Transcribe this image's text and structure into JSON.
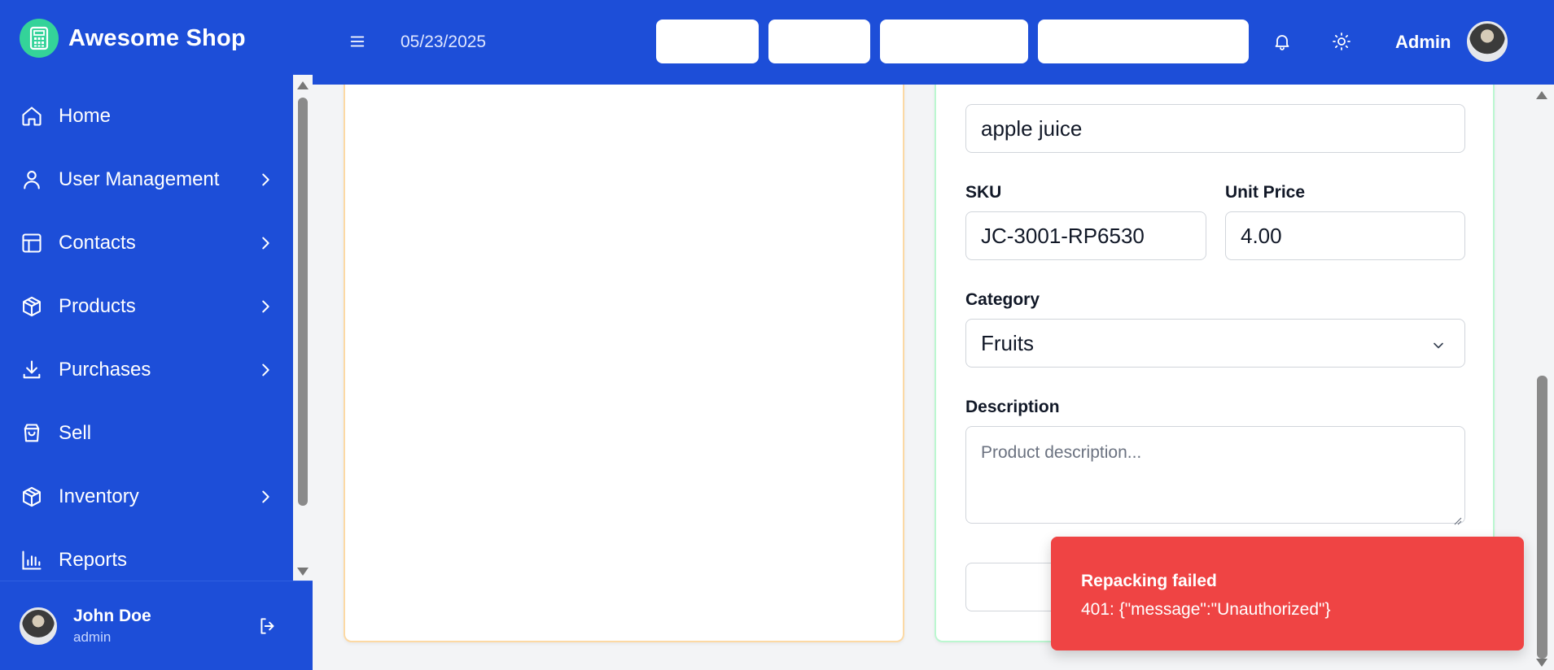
{
  "brand": {
    "name": "Awesome Shop",
    "icon": "calculator-icon",
    "color": "#34d399"
  },
  "colors": {
    "primary": "#1d4ed8",
    "toast": "#ef4444"
  },
  "sidebar": {
    "items": [
      {
        "label": "Home",
        "icon": "home-icon",
        "has_children": false
      },
      {
        "label": "User Management",
        "icon": "user-icon",
        "has_children": true
      },
      {
        "label": "Contacts",
        "icon": "layout-icon",
        "has_children": true
      },
      {
        "label": "Products",
        "icon": "box-icon",
        "has_children": true
      },
      {
        "label": "Purchases",
        "icon": "download-icon",
        "has_children": true
      },
      {
        "label": "Sell",
        "icon": "shopping-bag-icon",
        "has_children": false
      },
      {
        "label": "Inventory",
        "icon": "box-icon",
        "has_children": true
      },
      {
        "label": "Reports",
        "icon": "bar-chart-icon",
        "has_children": false
      }
    ]
  },
  "current_user": {
    "name": "John Doe",
    "role": "admin"
  },
  "header": {
    "date": "05/23/2025",
    "user_label": "Admin"
  },
  "form": {
    "name_value": "apple juice",
    "sku_label": "SKU",
    "sku_value": "JC-3001-RP6530",
    "unit_price_label": "Unit Price",
    "unit_price_value": "4.00",
    "category_label": "Category",
    "category_value": "Fruits",
    "description_label": "Description",
    "description_placeholder": "Product description..."
  },
  "toast": {
    "title": "Repacking failed",
    "message": "401: {\"message\":\"Unauthorized\"}"
  }
}
